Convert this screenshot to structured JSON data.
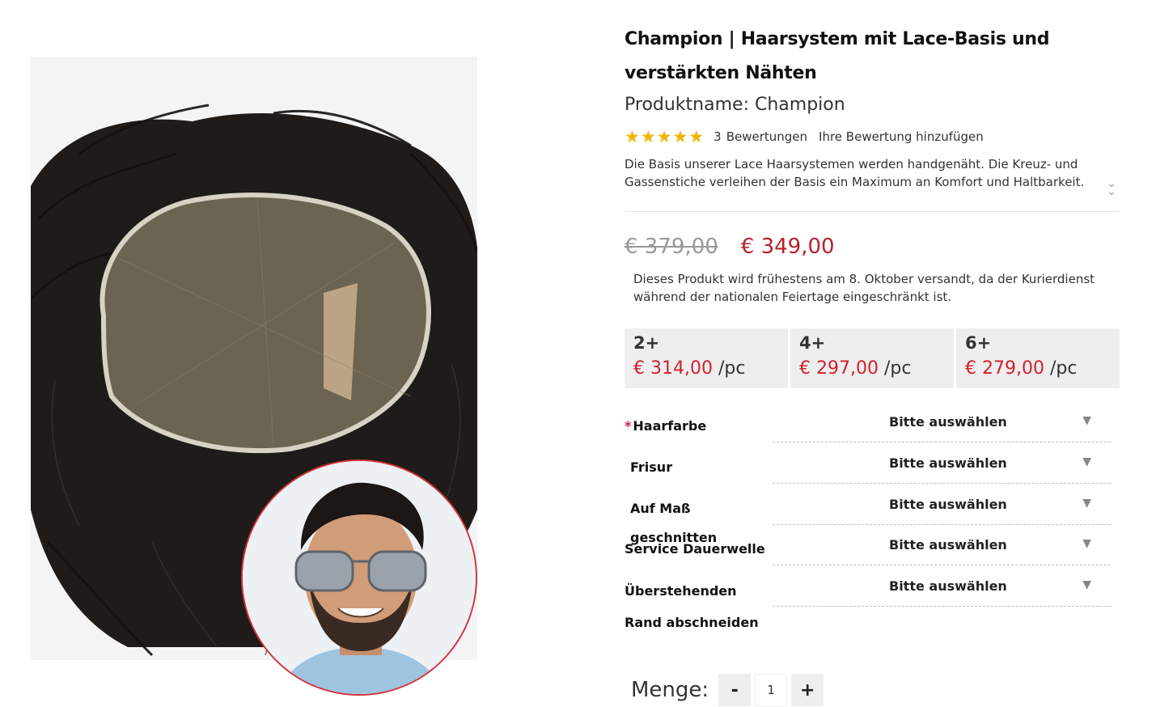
{
  "product": {
    "title": "Champion | Haarsystem mit Lace-Basis und verstärkten Nähten",
    "subtitle": "Produktname: Champion",
    "rating": {
      "stars": 5,
      "review_count": "3",
      "reviews_label": "Bewertungen",
      "add_review_label": "Ihre Bewertung hinzufügen"
    },
    "description": "Die Basis unserer Lace Haarsystemen werden handgenäht. Die Kreuz- und Gassenstiche verleihen der Basis ein Maximum an Komfort und Haltbarkeit.",
    "old_price": "€ 379,00",
    "price": "€ 349,00",
    "shipping_note": "Dieses Produkt wird frühestens am 8. Oktober versandt, da der Kurierdienst während der nationalen Feiertage eingeschränkt ist."
  },
  "tiers": [
    {
      "qty": "2+",
      "price": "€ 314,00",
      "unit": "/pc"
    },
    {
      "qty": "4+",
      "price": "€ 297,00",
      "unit": "/pc"
    },
    {
      "qty": "6+",
      "price": "€ 279,00",
      "unit": "/pc"
    }
  ],
  "options": [
    {
      "label": "Haarfarbe",
      "required": "*",
      "value": "Bitte auswählen"
    },
    {
      "label": "Frisur",
      "value": "Bitte auswählen"
    },
    {
      "label": "Auf Maß geschnitten",
      "value": "Bitte auswählen"
    },
    {
      "label": "Service Dauerwelle",
      "value": "Bitte auswählen"
    },
    {
      "label": "Überstehenden Rand abschneiden",
      "value": "Bitte auswählen"
    }
  ],
  "quantity": {
    "label": "Menge:",
    "value": "1",
    "minus": "-",
    "plus": "+"
  },
  "icons": {
    "star": "star-icon",
    "expand": "double-chevron-down-icon",
    "dropdown": "triangle-down-icon"
  },
  "colors": {
    "accent": "#b8202d",
    "star": "#f4b400",
    "tier_bg": "#eeeeee"
  }
}
